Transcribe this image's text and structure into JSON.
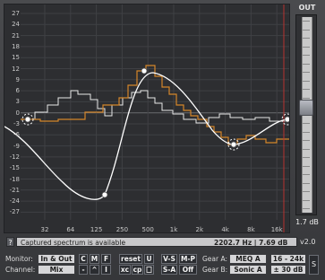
{
  "graph": {
    "db_labels": [
      "27",
      "24",
      "21",
      "18",
      "15",
      "12",
      "9",
      "6",
      "3",
      "0",
      "-3",
      "-6",
      "-9",
      "-12",
      "-15",
      "-18",
      "-21",
      "-24",
      "-27"
    ],
    "freq_labels": [
      "32",
      "64",
      "125",
      "250",
      "500",
      "1k",
      "2k",
      "4k",
      "8k",
      "16k"
    ],
    "colors": {
      "background": "#2d2e31",
      "grid": "#3f4044",
      "zero_line": "#6a6b70",
      "eq_curve": "#ffffff",
      "spectrum_white": "#e8e8e8",
      "spectrum_orange": "#d4862a",
      "limit_line": "#b8322e"
    }
  },
  "meter": {
    "title": "OUT",
    "readout": "1.7 dB",
    "level_fraction": 0.46
  },
  "status": {
    "help_label": "?",
    "message": "Captured spectrum is available",
    "readout": "2202.7 Hz | 7.69 dB",
    "version": "v2.0"
  },
  "controls": {
    "monitor_label": "Monitor:",
    "channel_label": "Channel:",
    "monitor_value": "In & Out",
    "channel_value": "Mix",
    "c_label": "C",
    "m_label": "M",
    "f_label": "F",
    "minus_label": "-",
    "caret_label": "^",
    "i_label": "I",
    "reset_label": "reset",
    "u_label": "U",
    "xc_label": "xc",
    "cp_label": "cp",
    "paste_label": "",
    "vs_label": "V-S",
    "mp_label": "M-P",
    "sa_label": "S-A",
    "off_label": "Off",
    "gear_a_label": "Gear A:",
    "gear_b_label": "Gear B:",
    "gear_a_value": "MEQ A",
    "gear_b_value": "Sonic A",
    "range_value": "16 - 24k",
    "db_range_value": "± 30 dB",
    "s_label": "S"
  }
}
